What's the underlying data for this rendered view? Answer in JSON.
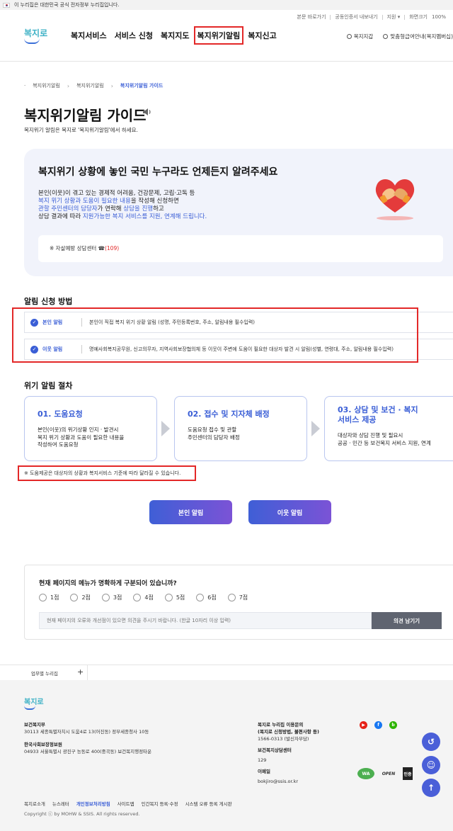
{
  "gov_bar": {
    "text": "이 누리집은 대한민국 공식 전자정부 누리집입니다."
  },
  "utility": {
    "links": [
      "본문 바로가기",
      "공동인증서 내보내기",
      "지원 ▾",
      "화면크기",
      "100%"
    ]
  },
  "header": {
    "logo": "복지로",
    "menu": [
      "복지서비스",
      "서비스 신청",
      "복지지도",
      "복지위기알림",
      "복지신고"
    ],
    "active_menu": "복지위기알림",
    "right_links": [
      "복지지갑",
      "맞춤형급여안내(복지멤버십)"
    ]
  },
  "breadcrumb": [
    "복지위기알림",
    "복지위기알림",
    "복지위기알림 가이드"
  ],
  "page": {
    "title": "복지위기알림 가이드",
    "subtitle": "복지위기 알림은 복지로 '복지위기알림'에서 하세요."
  },
  "hero": {
    "title": "복지위기 상황에 놓인 국민 누구라도 언제든지 알려주세요",
    "line1": "본인(이웃)이 겪고 있는 경제적 어려움, 건강문제, 고립·고독 등",
    "line2_blue": "복지 위기 상황과 도움이 필요한 내용",
    "line2_rest": "을 작성해 신청하면",
    "line3_blue1": "관할 주민센터의 담당자",
    "line3_mid": "가 연락해 ",
    "line3_blue2": "상담을 진행",
    "line3_rest": "하고",
    "line4_start": "상담 결과에 따라 ",
    "line4_blue": "지원가능한 복지 서비스를 지원, 연계해 드립니다.",
    "hotline_label": "※ 자살예방 상담센터 ☎",
    "hotline_number": "(109)"
  },
  "apply": {
    "heading": "알림 신청 방법",
    "rows": [
      {
        "label": "본인 알림",
        "desc": "본인이 직접 복지 위기 상황 알림 (성명, 주민등록번호, 주소, 알림내용 필수입력)"
      },
      {
        "label": "이웃 알림",
        "desc": "명예사회복지공무원, 신고의무자, 지역사회보장협의체 등 이웃이 주변에 도움이 필요한 대상자 발견 시 알림(성별, 연령대, 주소, 알림내용 필수입력)"
      }
    ]
  },
  "process": {
    "heading": "위기 알림 절차",
    "steps": [
      {
        "title": "01. 도움요청",
        "title2": "",
        "body": [
          "본인(이웃)의 위기상황 인지 · 발견시",
          "복지 위기 상황과 도움이 필요한 내용을",
          "작성하여 도움요청"
        ]
      },
      {
        "title": "02. 접수 및 지자체 배정",
        "title2": "",
        "body": [
          "도움요청 접수 및 관할",
          "주민센터의 담당자 배정"
        ]
      },
      {
        "title": "03. 상담 및 보건 · 복지",
        "title2": "서비스 제공",
        "body": [
          "대상자와 상담 진행 및 필요시",
          "공공 · 민간 등 보건복지 서비스 지원, 연계"
        ]
      }
    ],
    "note": "※ 도움제공은 대상자의 상황과 복지서비스 기준에 따라 달라질 수 있습니다."
  },
  "buttons": {
    "self": "본인 알림",
    "neighbor": "이웃 알림"
  },
  "survey": {
    "question": "현재 페이지의 메뉴가 명확하게 구분되어 있습니까?",
    "options": [
      "1점",
      "2점",
      "3점",
      "4점",
      "5점",
      "6점",
      "7점"
    ],
    "placeholder": "현재 페이지의 오류와 개선점이 있으면 의견을 주시기 바랍니다. (한글 10자리 이상 입력)",
    "submit": "의견 남기기"
  },
  "footer_tab": {
    "label": "업무별 누리집",
    "plus": "+"
  },
  "footer": {
    "logo": "복지로",
    "org1_name": "보건복지부",
    "org1_addr": "30113 세종특별자치시 도움4로 13(어진동) 정부세종청사 10동",
    "org2_name": "한국사회보장정보원",
    "org2_addr": "04933 서울특별시 광진구 능동로 400(중곡동) 보건복지행정타운",
    "inquiry_title": "복지로 누리집 이용문의",
    "inquiry_sub": "(복지로 신청방법, 불편사항 등)",
    "inquiry_phone": "1566-0313 (발신자부담)",
    "consult_title": "보건복지상담센터",
    "consult_phone": "129",
    "email_title": "이메일",
    "email": "bokjiro@ssis.or.kr",
    "sns": [
      "YouTube",
      "Facebook",
      "Blog"
    ],
    "badges": [
      "WA",
      "OPEN",
      "인증"
    ],
    "links": [
      "복지로소개",
      "뉴스레터",
      "개인정보처리방침",
      "사이트맵",
      "인간복지 등록·수정",
      "시스템 오류 등록 게시판"
    ],
    "highlight_link": "개인정보처리방침",
    "copyright": "Copyright ⓒ by MOHW & SSIS. All rights reserved."
  },
  "colors": {
    "accent": "#3a5ed6",
    "highlight_box": "#e32828",
    "hero_bg": "#f1f3fb",
    "footer_bg": "#f4f4f4"
  }
}
